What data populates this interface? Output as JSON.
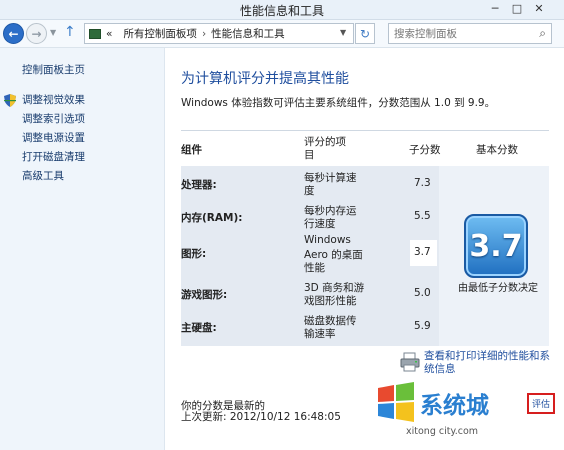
{
  "window": {
    "title": "性能信息和工具",
    "minimize": "─",
    "maximize": "□",
    "close": "✕"
  },
  "address": {
    "back_icon": "←",
    "forward_icon": "→",
    "up_icon": "↑",
    "overflow": "«",
    "crumbs": [
      "所有控制面板项",
      "性能信息和工具"
    ],
    "separator": "›",
    "refresh_icon": "↻",
    "search_placeholder": "搜索控制面板",
    "search_icon": "⌕"
  },
  "sidebar": {
    "home": "控制面板主页",
    "items": [
      {
        "label": "调整视觉效果",
        "icon": "shield-icon"
      },
      {
        "label": "调整索引选项"
      },
      {
        "label": "调整电源设置"
      },
      {
        "label": "打开磁盘清理"
      },
      {
        "label": "高级工具"
      }
    ]
  },
  "main": {
    "heading": "为计算机评分并提高其性能",
    "subtext": "Windows 体验指数可评估主要系统组件，分数范围从 1.0 到 9.9。",
    "table": {
      "headers": {
        "component": "组件",
        "rated_line1": "评分的项",
        "rated_line2": "目",
        "subscore": "子分数",
        "basescore": "基本分数"
      },
      "rows": [
        {
          "component": "处理器:",
          "desc1": "每秒计算速",
          "desc2": "度",
          "desc3": "",
          "score": "7.3"
        },
        {
          "component": "内存(RAM):",
          "desc1": "每秒内存运",
          "desc2": "行速度",
          "desc3": "",
          "score": "5.5"
        },
        {
          "component": "图形:",
          "desc1": "Windows",
          "desc2": "Aero 的桌面",
          "desc3": "性能",
          "score": "3.7"
        },
        {
          "component": "游戏图形:",
          "desc1": "3D 商务和游",
          "desc2": "戏图形性能",
          "desc3": "",
          "score": "5.0"
        },
        {
          "component": "主硬盘:",
          "desc1": "磁盘数据传",
          "desc2": "输速率",
          "desc3": "",
          "score": "5.9"
        }
      ],
      "base_score": "3.7",
      "base_caption": "由最低子分数决定"
    },
    "report_link": "查看和打印详细的性能和系统信息",
    "status_line1": "你的分数是最新的",
    "status_line2": "上次更新: 2012/10/12 16:48:05"
  },
  "watermark": {
    "text": "系统城",
    "url": "xitong city.com",
    "boxed_fragment": "评估"
  }
}
